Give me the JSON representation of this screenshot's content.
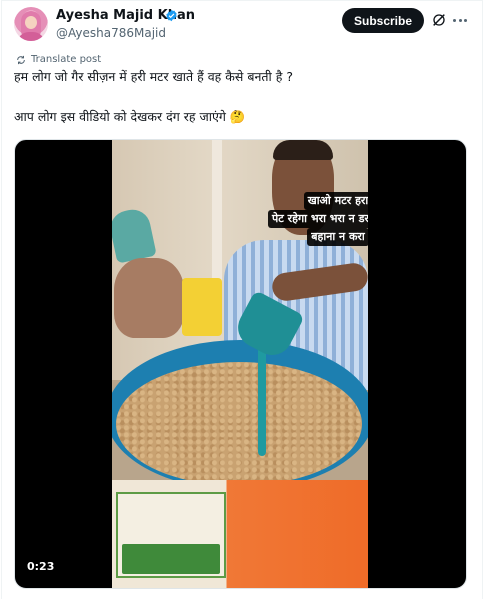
{
  "author": {
    "display_name": "Ayesha Majid Khan",
    "handle": "@Ayesha786Majid",
    "verified": true
  },
  "header": {
    "subscribe_label": "Subscribe",
    "icons": [
      "grok-icon",
      "more-icon"
    ]
  },
  "translate": {
    "label": "Translate post",
    "icon": "translate-icon"
  },
  "tweet": {
    "line1": "हम लोग जो गैर सीज़न में हरी मटर खाते हैं वह कैसे बनती है ?",
    "line2": "आप लोग इस वीडियो को देखकर दंग रह जाएंगे 🤔"
  },
  "video": {
    "caption_lines": [
      "खाओ मटर हरा",
      "पेट रहेगा भरा भरा न डरा खाए में",
      "बहाना न करा"
    ],
    "timestamp": "0:23"
  },
  "colors": {
    "text": "#0f1419",
    "secondary": "#536471",
    "verified": "#1d9bf0",
    "button_bg": "#0f1419"
  }
}
